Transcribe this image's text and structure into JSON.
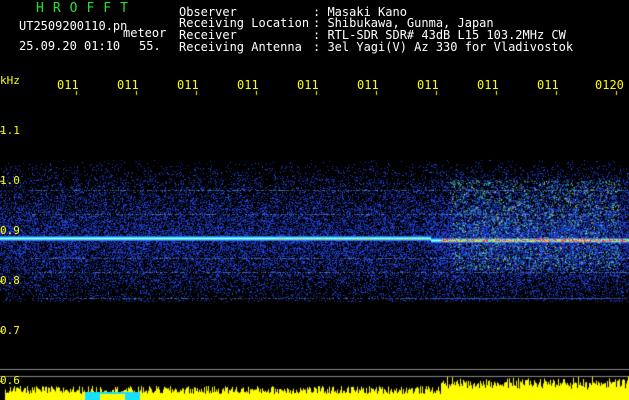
{
  "header": {
    "app_title": "HROFFT",
    "filename": "UT2509200110.pn",
    "mode": "meteor",
    "date_time": "25.09.20 01:10",
    "value": "55."
  },
  "info": [
    {
      "label": "Observer",
      "value": ": Masaki Kano"
    },
    {
      "label": "Receiving Location",
      "value": ": Shibukawa, Gunma, Japan"
    },
    {
      "label": "Receiver",
      "value": ": RTL-SDR SDR# 43dB L15 103.2MHz CW"
    },
    {
      "label": "Receiving Antenna",
      "value": ": 3el Yagi(V) Az 330 for Vladivostok"
    }
  ],
  "axis": {
    "unit": "kHz",
    "y_ticks": [
      "1.1",
      "1.0",
      "0.9",
      "0.8",
      "0.7",
      "0.6"
    ],
    "x_ticks": [
      "011",
      "011",
      "011",
      "011",
      "011",
      "011",
      "011",
      "011",
      "011",
      "0120"
    ]
  },
  "colors": {
    "background": "#000000",
    "label_yellow": "#ffff00",
    "title_green": "#22e32b",
    "signal_blue": "#1b3cff",
    "cyan": "#33ffff",
    "red": "#ff2255"
  }
}
